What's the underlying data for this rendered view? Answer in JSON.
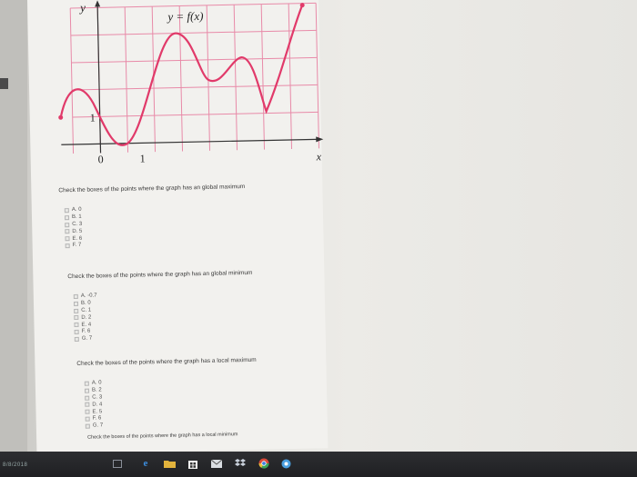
{
  "graph": {
    "function_label": "y = f(x)",
    "y_axis": "y",
    "x_axis": "x",
    "origin_label": "0",
    "x_tick": "1",
    "y_tick": "1"
  },
  "questions": [
    {
      "prompt": "Check the boxes of the points where the graph has an global maximum",
      "options": [
        "A. 0",
        "B. 1",
        "C. 3",
        "D. 5",
        "E. 6",
        "F. 7"
      ]
    },
    {
      "prompt": "Check the boxes of the points where the graph has an global minimum",
      "options": [
        "A. -0.7",
        "B. 0",
        "C. 1",
        "D. 2",
        "E. 4",
        "F. 6",
        "G. 7"
      ]
    },
    {
      "prompt": "Check the boxes of the points where the graph has a local maximum",
      "options": [
        "A. 0",
        "B. 2",
        "C. 3",
        "D. 4",
        "E. 5",
        "F. 6",
        "G. 7"
      ]
    },
    {
      "prompt": "Check the boxes of the points where the graph has a local minimum"
    }
  ],
  "taskbar": {
    "left_text": "8/8/2018"
  },
  "colors": {
    "curve": "#e13a6a",
    "grid": "#e88aa8",
    "taskbar": "#242528"
  }
}
